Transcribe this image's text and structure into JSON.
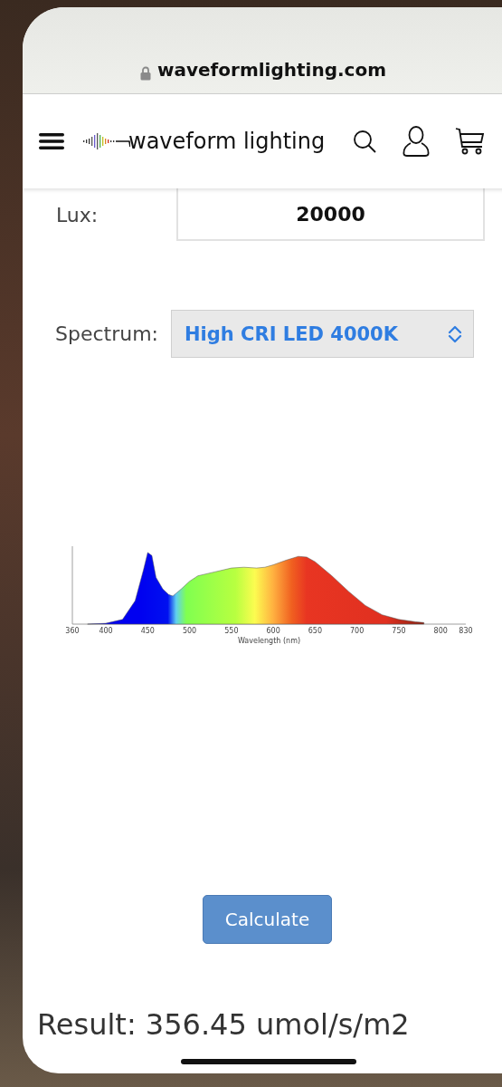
{
  "browser": {
    "url": "waveformlighting.com"
  },
  "header": {
    "logo_text": "waveform lighting"
  },
  "lux": {
    "label": "Lux:",
    "value": "20000"
  },
  "spectrum": {
    "label": "Spectrum:",
    "value": "High CRI LED 4000K"
  },
  "chart": {
    "xlabel": "Wavelength (nm)",
    "xtick_labels": [
      "360",
      "400",
      "450",
      "500",
      "550",
      "600",
      "650",
      "700",
      "750",
      "800",
      "830"
    ]
  },
  "calculate_button": {
    "label": "Calculate"
  },
  "result": {
    "text": "Result: 356.45 umol/s/m2"
  }
}
